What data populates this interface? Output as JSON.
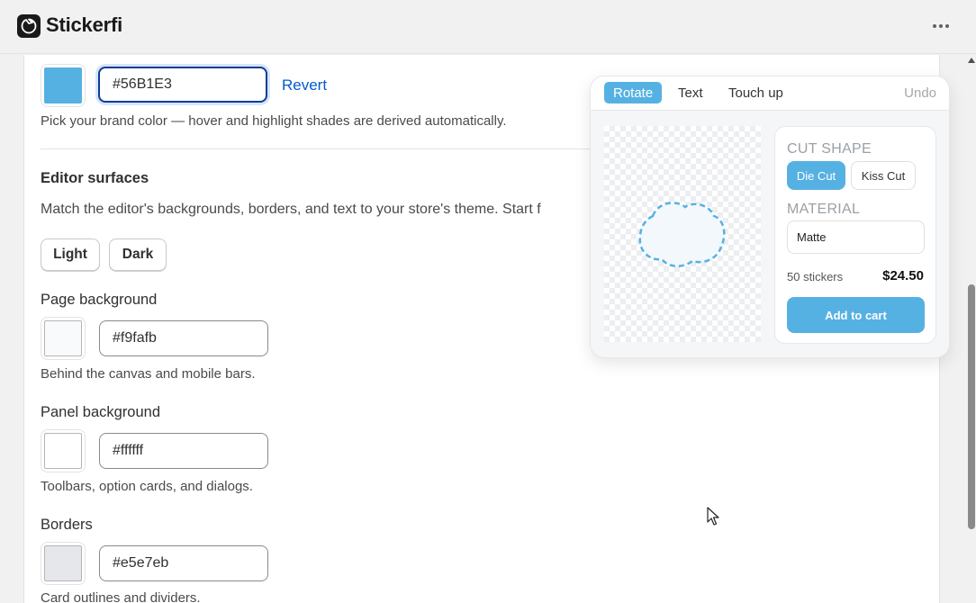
{
  "app": {
    "title": "Stickerfi",
    "logo_icon": "stickerfi-logo-icon",
    "menu_icon": "more-horizontal-icon"
  },
  "brand": {
    "color": "#56B1E3",
    "input_value": "#56B1E3",
    "revert_label": "Revert",
    "help": "Pick your brand color — hover and highlight shades are derived automatically."
  },
  "surfaces": {
    "heading": "Editor surfaces",
    "description": "Match the editor's backgrounds, borders, and text to your store's theme. Start f",
    "presets": [
      "Light",
      "Dark"
    ],
    "fields": [
      {
        "label": "Page background",
        "value": "#f9fafb",
        "help": "Behind the canvas and mobile bars."
      },
      {
        "label": "Panel background",
        "value": "#ffffff",
        "help": "Toolbars, option cards, and dialogs."
      },
      {
        "label": "Borders",
        "value": "#e5e7eb",
        "help": "Card outlines and dividers."
      }
    ]
  },
  "preview": {
    "tabs": [
      "Rotate",
      "Text",
      "Touch up"
    ],
    "active_tab": "Rotate",
    "undo_label": "Undo",
    "cut_shape_label": "CUT SHAPE",
    "cut_shapes": [
      "Die Cut",
      "Kiss Cut"
    ],
    "selected_cut": "Die Cut",
    "material_label": "MATERIAL",
    "material_value": "Matte",
    "quantity": "50 stickers",
    "price": "$24.50",
    "cta_label": "Add to cart"
  }
}
